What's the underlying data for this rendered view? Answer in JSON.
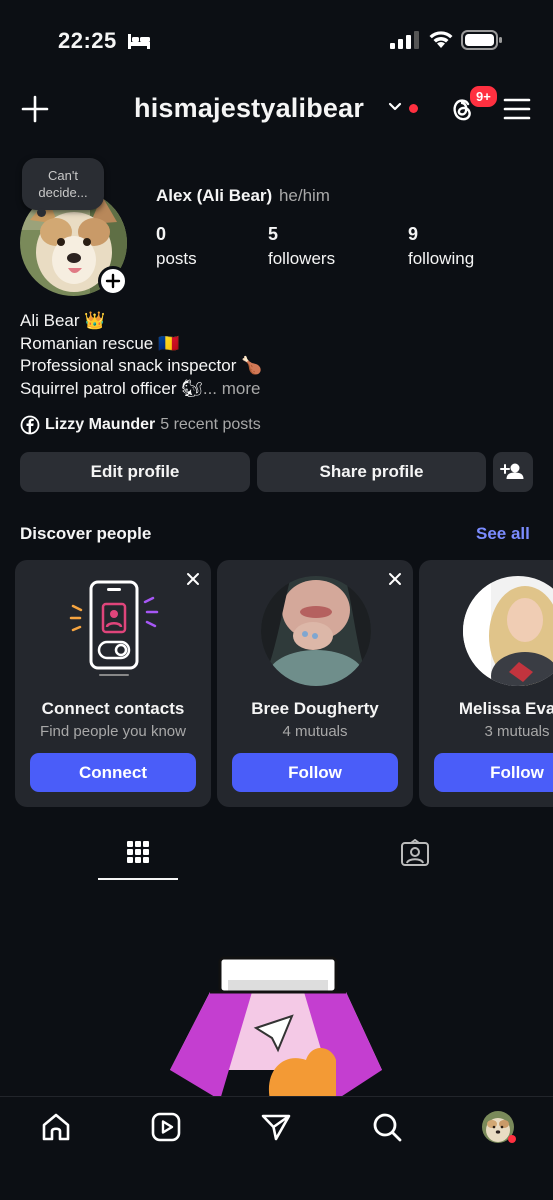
{
  "status": {
    "time": "22:25"
  },
  "header": {
    "username": "hismajestyalibear",
    "notification_badge": "9+"
  },
  "note": {
    "line1": "Can't",
    "line2": "decide..."
  },
  "profile": {
    "display_name": "Alex (Ali Bear)",
    "pronouns": "he/him",
    "stats": [
      {
        "value": "0",
        "label": "posts"
      },
      {
        "value": "5",
        "label": "followers"
      },
      {
        "value": "9",
        "label": "following"
      }
    ],
    "bio": [
      "Ali Bear 👑",
      "Romanian rescue 🇷🇴",
      "Professional snack inspector 🍗",
      "Squirrel patrol officer 🐿"
    ],
    "bio_more": "... more",
    "linked_name": "Lizzy Maunder",
    "linked_sub": "5 recent posts"
  },
  "actions": {
    "edit": "Edit profile",
    "share": "Share profile"
  },
  "discover": {
    "title": "Discover people",
    "see_all": "See all",
    "cards": [
      {
        "name": "Connect contacts",
        "sub": "Find people you know",
        "button": "Connect"
      },
      {
        "name": "Bree Dougherty",
        "sub": "4 mutuals",
        "button": "Follow"
      },
      {
        "name": "Melissa Evans",
        "sub": "3 mutuals",
        "button": "Follow"
      }
    ]
  },
  "colors": {
    "accent": "#4a5df9",
    "link": "#7b8cff",
    "notification": "#ff3040",
    "background": "#0c0f14",
    "card": "#24272d"
  }
}
